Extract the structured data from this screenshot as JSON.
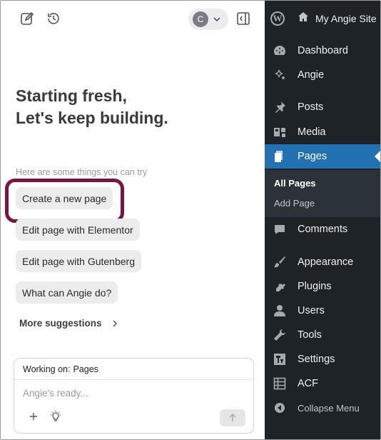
{
  "angie": {
    "greeting_line1": "Starting fresh,",
    "greeting_line2": "Let's keep building.",
    "hint": "Here are some things you can try",
    "suggestions": [
      "Create a new page",
      "Edit page with Elementor",
      "Edit page with Gutenberg",
      "What can Angie do?"
    ],
    "more_label": "More suggestions",
    "avatar_initial": "C",
    "composer": {
      "working_on_label": "Working on:",
      "working_on_value": "Pages",
      "placeholder": "Angie's ready..."
    }
  },
  "wp": {
    "site_name": "My Angie Site",
    "menu": [
      {
        "label": "Dashboard",
        "icon": "dashboard-icon"
      },
      {
        "label": "Angie",
        "icon": "sparkle-icon"
      },
      {
        "label": "Posts",
        "icon": "pin-icon"
      },
      {
        "label": "Media",
        "icon": "media-icon"
      },
      {
        "label": "Pages",
        "icon": "pages-icon",
        "active": true
      },
      {
        "label": "Comments",
        "icon": "comment-icon"
      },
      {
        "label": "Appearance",
        "icon": "brush-icon"
      },
      {
        "label": "Plugins",
        "icon": "plug-icon"
      },
      {
        "label": "Users",
        "icon": "user-icon"
      },
      {
        "label": "Tools",
        "icon": "wrench-icon"
      },
      {
        "label": "Settings",
        "icon": "settings-icon"
      },
      {
        "label": "ACF",
        "icon": "acf-icon"
      },
      {
        "label": "Collapse Menu",
        "icon": "collapse-icon"
      }
    ],
    "submenu": [
      "All Pages",
      "Add Page"
    ]
  },
  "colors": {
    "accent": "#2271b1",
    "admin_bg": "#1d2327",
    "highlight": "#7d1343"
  }
}
